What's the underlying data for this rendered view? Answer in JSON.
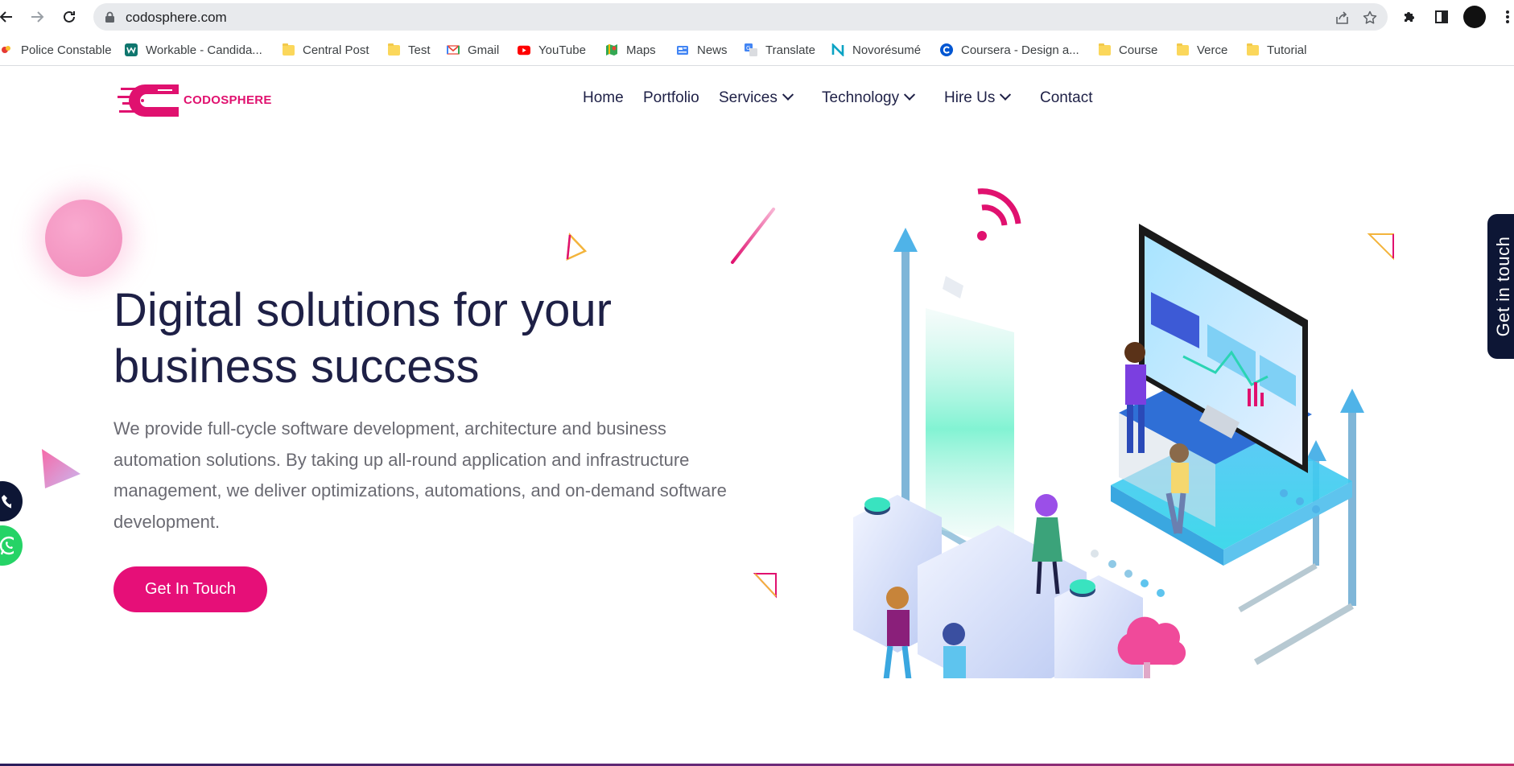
{
  "browser": {
    "url": "codosphere.com",
    "bookmarks": [
      {
        "label": "Police Constable",
        "icon": "favicon-icon"
      },
      {
        "label": "Workable - Candida...",
        "icon": "workable-icon"
      },
      {
        "label": "Central Post",
        "icon": "folder-icon"
      },
      {
        "label": "Test",
        "icon": "folder-icon"
      },
      {
        "label": "Gmail",
        "icon": "gmail-icon"
      },
      {
        "label": "YouTube",
        "icon": "youtube-icon"
      },
      {
        "label": "Maps",
        "icon": "maps-icon"
      },
      {
        "label": "News",
        "icon": "news-icon"
      },
      {
        "label": "Translate",
        "icon": "translate-icon"
      },
      {
        "label": "Novorésumé",
        "icon": "novoresume-icon"
      },
      {
        "label": "Coursera - Design a...",
        "icon": "coursera-icon"
      },
      {
        "label": "Course",
        "icon": "folder-icon"
      },
      {
        "label": "Verce",
        "icon": "folder-icon"
      },
      {
        "label": "Tutorial",
        "icon": "folder-icon"
      }
    ]
  },
  "site": {
    "brand": "CODOSPHERE",
    "nav": {
      "home": "Home",
      "portfolio": "Portfolio",
      "services": "Services",
      "technology": "Technology",
      "hire_us": "Hire Us",
      "contact": "Contact"
    },
    "hero": {
      "title_line1": "Digital solutions for your",
      "title_line2": "business success",
      "description": "We provide full-cycle software development, architecture and business automation solutions. By taking up all-round application and infrastructure management, we deliver optimizations, automations, and on-demand software development.",
      "cta": "Get In Touch"
    },
    "side_tab": "Get in touch",
    "colors": {
      "accent": "#e60f78",
      "heading": "#1e2046",
      "body_text": "#6a6a72",
      "side_tab": "#0d1635"
    }
  }
}
